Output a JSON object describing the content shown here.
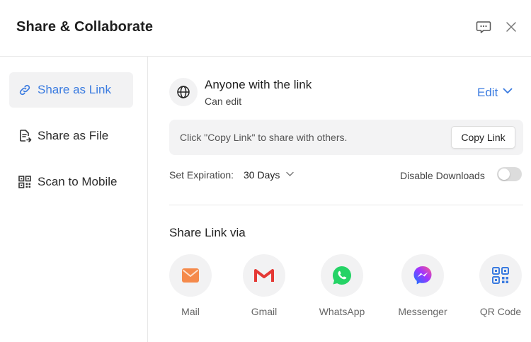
{
  "header": {
    "title": "Share & Collaborate",
    "feedback_icon": "feedback-icon",
    "close_icon": "close-icon"
  },
  "sidebar": {
    "items": [
      {
        "label": "Share as Link",
        "icon": "link-icon",
        "active": true
      },
      {
        "label": "Share as File",
        "icon": "file-share-icon",
        "active": false
      },
      {
        "label": "Scan to Mobile",
        "icon": "qr-code-icon",
        "active": false
      }
    ]
  },
  "access": {
    "who": "Anyone with the link",
    "permission": "Can edit",
    "edit_label": "Edit"
  },
  "copy": {
    "hint": "Click \"Copy Link\" to share with others.",
    "button_label": "Copy Link"
  },
  "expiration": {
    "label": "Set Expiration:",
    "value": "30 Days"
  },
  "downloads": {
    "label": "Disable Downloads",
    "enabled": false
  },
  "share_via": {
    "title": "Share Link via",
    "options": [
      {
        "name": "Mail",
        "icon": "mail-icon"
      },
      {
        "name": "Gmail",
        "icon": "gmail-icon"
      },
      {
        "name": "WhatsApp",
        "icon": "whatsapp-icon"
      },
      {
        "name": "Messenger",
        "icon": "messenger-icon"
      },
      {
        "name": "QR Code",
        "icon": "qr-code-icon"
      }
    ]
  },
  "colors": {
    "accent": "#3a7be0",
    "active_bg": "#f2f2f3",
    "gmail_red": "#e53935",
    "whatsapp_green": "#25d366",
    "mail_orange": "#f58a4b"
  }
}
